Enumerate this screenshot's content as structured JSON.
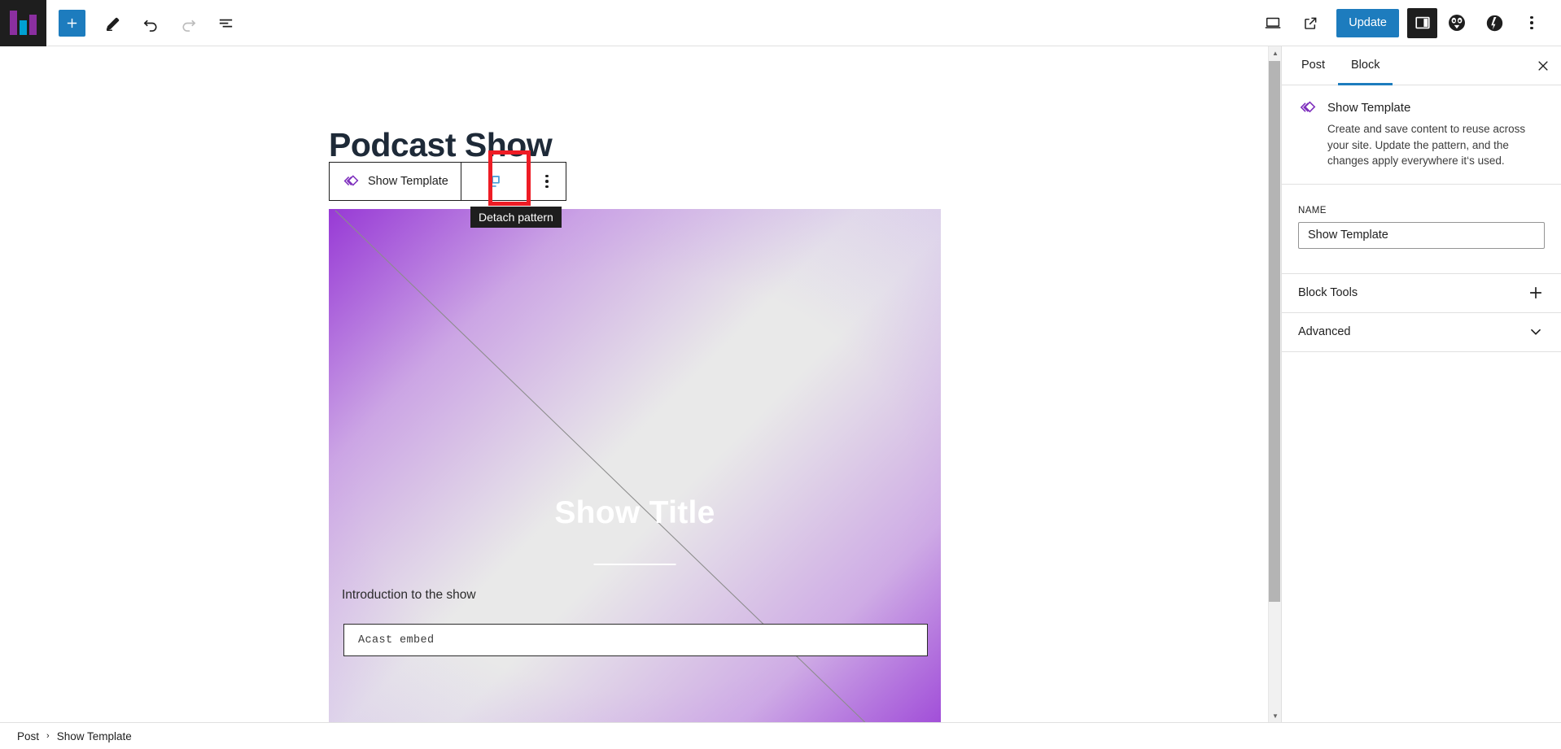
{
  "app": {
    "logo": "bar-chart-logo"
  },
  "toolbar": {
    "add_block_label": "+",
    "tools": [
      {
        "name": "add-block",
        "icon": "plus-icon",
        "label": "+"
      },
      {
        "name": "edit-tools",
        "icon": "pencil-icon",
        "label": ""
      },
      {
        "name": "undo",
        "icon": "undo-icon",
        "label": ""
      },
      {
        "name": "redo",
        "icon": "redo-icon",
        "label": ""
      },
      {
        "name": "list-view",
        "icon": "list-view-icon",
        "label": ""
      }
    ],
    "right": {
      "view_label": "",
      "preview_icon": "desktop-icon",
      "external_icon": "external-link-icon",
      "update_label": "Update",
      "settings_icon": "sidebar-panel-icon",
      "jetpack_icon": "jetpack-icon",
      "yoast_icon": "yoast-seo-icon",
      "more_icon": "kebab-menu-icon"
    }
  },
  "canvas": {
    "ghost_heading": "Podcast Show",
    "block_toolbar": {
      "block_label": "Show Template",
      "block_icon": "pattern-icon",
      "detach_icon": "detach-pattern-icon",
      "more_icon": "vertical-dots-icon",
      "tooltip": "Detach pattern"
    },
    "cover": {
      "title": "Show Title",
      "intro": "Introduction to the show",
      "embed_placeholder": "Acast embed"
    }
  },
  "sidebar": {
    "tabs": [
      {
        "label": "Post",
        "active": false
      },
      {
        "label": "Block",
        "active": true
      }
    ],
    "close_label": "×",
    "block": {
      "title": "Show Template",
      "description": "Create and save content to reuse across your site. Update the pattern, and the changes apply everywhere it‘s used."
    },
    "name_field": {
      "label": "NAME",
      "value": "Show Template",
      "placeholder": "Show Template"
    },
    "rows": [
      {
        "label": "Block Tools",
        "icon": "plus-icon"
      },
      {
        "label": "Advanced",
        "icon": "chevron-down-icon"
      }
    ]
  },
  "breadcrumb": {
    "items": [
      "Post",
      "Show Template"
    ],
    "separator": "›"
  },
  "colors": {
    "accent": "#1d7cbe",
    "highlight": "#ee1c25",
    "pattern_purple": "#8b2fa0",
    "dark": "#1e1e1e"
  }
}
